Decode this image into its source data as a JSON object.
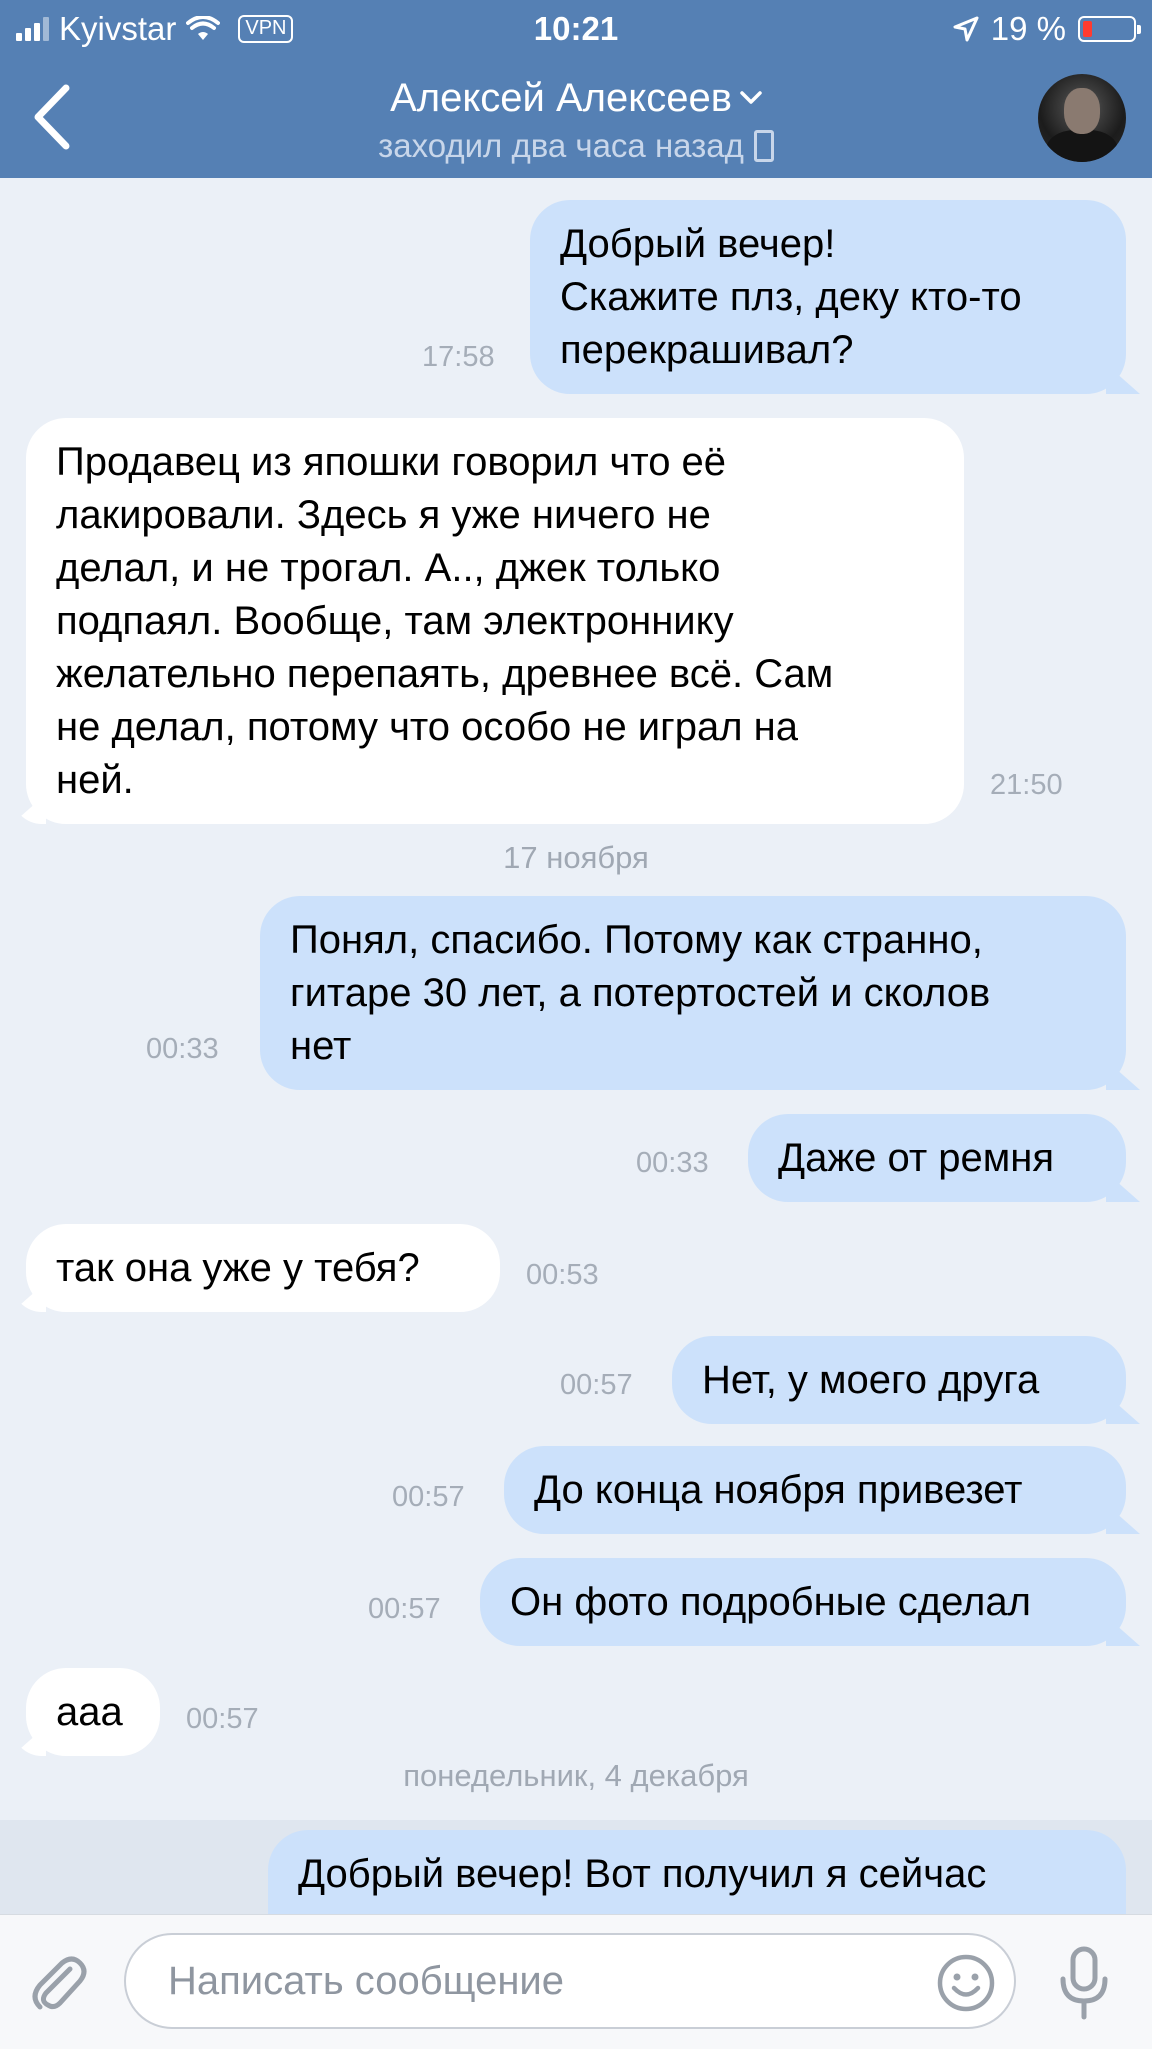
{
  "status_bar": {
    "carrier": "Kyivstar",
    "vpn": "VPN",
    "time": "10:21",
    "battery": "19 %",
    "battery_level": 0.19
  },
  "header": {
    "title": "Алексей Алексеев",
    "subtitle": "заходил два часа назад",
    "back_icon": "chevron-left-icon",
    "avatar": "contact-avatar"
  },
  "messages": [
    {
      "dir": "out",
      "text": "Добрый вечер!\nСкажите плз, деку кто-то\nперекрашивал?",
      "time": "17:58"
    },
    {
      "dir": "in",
      "text": "Продавец из япошки говорил что её\nлакировали. Здесь я уже ничего не\nделал, и не трогал. А.., джек только\nподпаял. Вообще, там электроннику\nжелательно перепаять, древнее всё. Сам\nне делал, потому что особо не играл на\nней.",
      "time": "21:50"
    },
    {
      "date": "17 ноября"
    },
    {
      "dir": "out",
      "text": "Понял, спасибо. Потому как странно,\nгитаре 30 лет, а потертостей и сколов\nнет",
      "time": "00:33"
    },
    {
      "dir": "out",
      "text": "Даже от ремня",
      "time": "00:33"
    },
    {
      "dir": "in",
      "text": "так она уже у тебя?",
      "time": "00:53"
    },
    {
      "dir": "out",
      "text": "Нет, у моего друга",
      "time": "00:57"
    },
    {
      "dir": "out",
      "text": "До конца ноября привезет",
      "time": "00:57"
    },
    {
      "dir": "out",
      "text": "Он фото подробные сделал",
      "time": "00:57"
    },
    {
      "dir": "in",
      "text": "ааа",
      "time": "00:57"
    },
    {
      "date": "понедельник, 4 декабря"
    },
    {
      "dir": "out",
      "text": "Добрый вечер! Вот получил я сейчас",
      "time": ""
    }
  ],
  "input": {
    "placeholder": "Написать сообщение",
    "attach_icon": "paperclip-icon",
    "emoji_icon": "smiley-icon",
    "mic_icon": "microphone-icon"
  },
  "colors": {
    "header": "#5580b4",
    "background": "#ebf0f7",
    "incoming_bubble": "#ffffff",
    "outgoing_bubble": "#cce1fb"
  }
}
